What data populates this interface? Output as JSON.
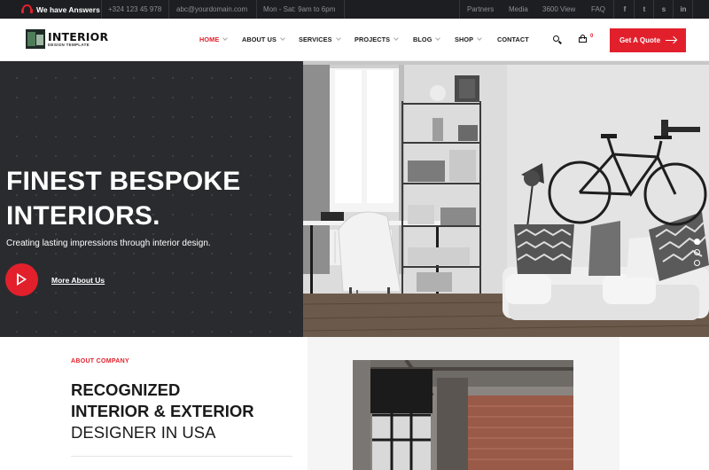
{
  "topbar": {
    "answers": "We have Answers",
    "phone": "+324 123 45 978",
    "email": "abc@yourdomain.com",
    "hours": "Mon - Sat: 9am to 6pm",
    "links": [
      "Partners",
      "Media",
      "3600 View",
      "FAQ"
    ],
    "social": [
      "f",
      "t",
      "s",
      "in"
    ]
  },
  "header": {
    "logo_name": "INTERIOR",
    "logo_tag": "DESIGN TEMPLATE",
    "nav": [
      "HOME",
      "ABOUT US",
      "SERVICES",
      "PROJECTS",
      "BLOG",
      "SHOP",
      "CONTACT"
    ],
    "cart_count": "0",
    "cta": "Get A Quote"
  },
  "hero": {
    "title_line1": "FINEST BESPOKE",
    "title_line2": "INTERIORS.",
    "subtitle": "Creating lasting impressions through interior design.",
    "link": "More About Us"
  },
  "about": {
    "label": "ABOUT COMPANY",
    "heading_line1": "RECOGNIZED",
    "heading_line2": "INTERIOR & EXTERIOR",
    "heading_line3": "DESIGNER IN USA"
  },
  "colors": {
    "accent": "#e2202c",
    "dark": "#2a2b2f",
    "topbar": "#1d1e22"
  },
  "icons": [
    "headphones-icon",
    "facebook-icon",
    "twitter-icon",
    "skype-icon",
    "linkedin-icon",
    "search-icon",
    "cart-icon",
    "arrow-right-icon",
    "play-icon"
  ]
}
